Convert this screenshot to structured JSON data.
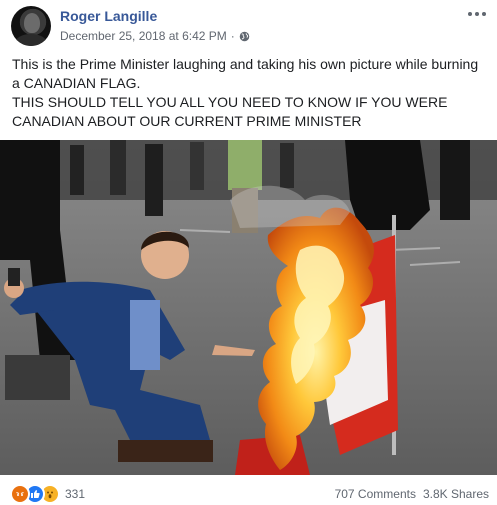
{
  "post": {
    "author": "Roger Langille",
    "timestamp": "December 25, 2018 at 6:42 PM",
    "separator": "·",
    "privacy_icon": "globe-icon",
    "text_line1": "This is the Prime Minister laughing and taking his own picture while burning a CANADIAN FLAG.",
    "text_line2": "THIS SHOULD TELL YOU ALL YOU NEED TO KNOW IF YOU WERE CANADIAN ABOUT OUR CURRENT PRIME MINISTER"
  },
  "footer": {
    "reaction_icons": [
      "angry-reaction-icon",
      "like-reaction-icon",
      "wow-reaction-icon"
    ],
    "reaction_count": "331",
    "comments": "707 Comments",
    "shares": "3.8K Shares"
  },
  "colors": {
    "author_link": "#385898",
    "meta_text": "#616770",
    "flag_red": "#d52b1e",
    "flame_orange": "#f28a16"
  }
}
